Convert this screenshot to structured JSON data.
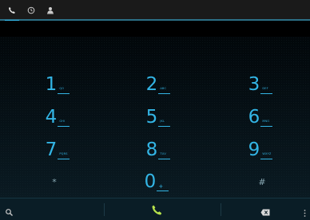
{
  "tabs": [
    {
      "name": "phone",
      "icon": "phone-icon"
    },
    {
      "name": "recent",
      "icon": "clock-icon"
    },
    {
      "name": "contacts",
      "icon": "person-icon"
    }
  ],
  "keypad": {
    "keys": [
      {
        "digit": "1",
        "letters": "QO"
      },
      {
        "digit": "2",
        "letters": "ABC"
      },
      {
        "digit": "3",
        "letters": "DEF"
      },
      {
        "digit": "4",
        "letters": "GHI"
      },
      {
        "digit": "5",
        "letters": "JKL"
      },
      {
        "digit": "6",
        "letters": "MNO"
      },
      {
        "digit": "7",
        "letters": "PQRS"
      },
      {
        "digit": "8",
        "letters": "TUV"
      },
      {
        "digit": "9",
        "letters": "WXYZ"
      },
      {
        "digit": "*",
        "letters": ""
      },
      {
        "digit": "0",
        "letters": "+"
      },
      {
        "digit": "#",
        "letters": ""
      }
    ]
  },
  "footer": {
    "search_icon": "search-icon",
    "call_icon": "phone-icon",
    "delete_icon": "backspace-icon",
    "overflow_icon": "overflow-menu-icon"
  },
  "colors": {
    "accent": "#33b5e5",
    "background": "#000000"
  }
}
